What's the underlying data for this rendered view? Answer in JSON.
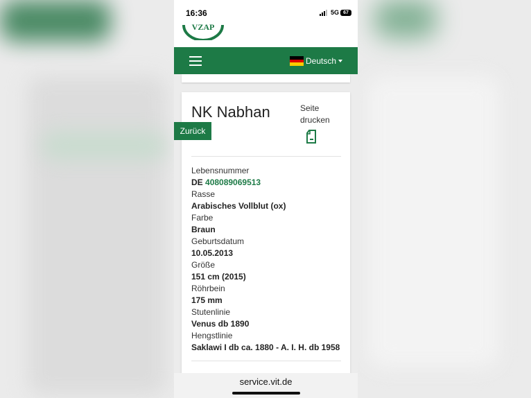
{
  "status_bar": {
    "time": "16:36",
    "network": "5G",
    "battery": "67"
  },
  "logo": {
    "text": "VZAP"
  },
  "nav": {
    "menu_icon": "hamburger-icon",
    "language": "Deutsch",
    "flag_colors": [
      "#000000",
      "#dd0000",
      "#ffcc00"
    ]
  },
  "horse": {
    "name": "NK Nabhan",
    "print_label": "Seite drucken",
    "back_label": "Zurück",
    "fields": [
      {
        "label": "Lebensnummer",
        "prefix": "DE ",
        "value": "408089069513"
      },
      {
        "label": "Rasse",
        "value": "Arabisches Vollblut (ox)"
      },
      {
        "label": "Farbe",
        "value": "Braun"
      },
      {
        "label": "Geburtsdatum",
        "value": "10.05.2013"
      },
      {
        "label": "Größe",
        "value": "151 cm (2015)"
      },
      {
        "label": "Röhrbein",
        "value": "175 mm"
      },
      {
        "label": "Stutenlinie",
        "value": "Venus db 1890"
      },
      {
        "label": "Hengstlinie",
        "value": "Saklawi I db ca. 1880 - A. I. H. db 1958"
      }
    ]
  },
  "browser": {
    "url": "service.vit.de"
  },
  "colors": {
    "brand_green": "#1d7a46"
  }
}
